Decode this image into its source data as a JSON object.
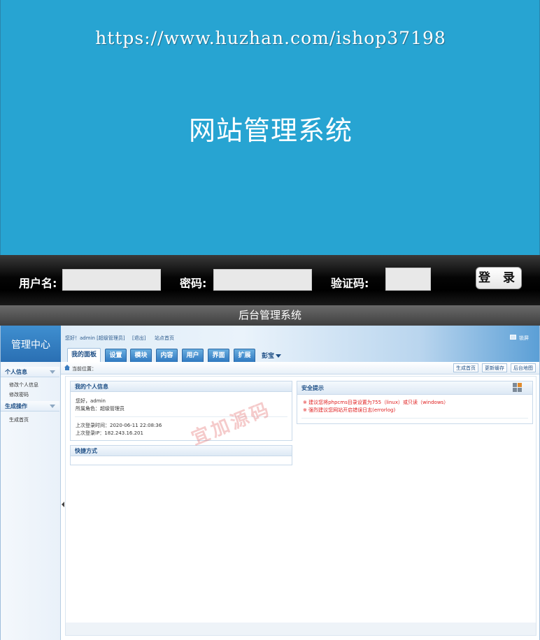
{
  "watermark_url": "https://www.huzhan.com/ishop37198",
  "login": {
    "title": "网站管理系统",
    "username_label": "用户名:",
    "password_label": "密码:",
    "captcha_label": "验证码:",
    "login_button": "登 录",
    "subtitle": "后台管理系统"
  },
  "admin": {
    "logo": "管理中心",
    "greeting": "您好！admin [超级管理员]",
    "logout": "[退出]",
    "site_home": "站点首页",
    "lock_screen": "锁屏",
    "tabs": [
      "我的面板",
      "设置",
      "模块",
      "内容",
      "用户",
      "界面",
      "扩展"
    ],
    "more_tab": "彭宝",
    "breadcrumb": "当前位置：",
    "quick_buttons": [
      "生成首页",
      "更新缓存",
      "后台地图"
    ],
    "sidebar": {
      "sections": [
        {
          "title": "个人信息",
          "items": [
            "修改个人信息",
            "修改密码"
          ]
        },
        {
          "title": "生成操作",
          "items": [
            "生成首页"
          ]
        }
      ]
    },
    "panels": {
      "my_info": {
        "title": "我的个人信息",
        "hello": "您好，admin",
        "role": "所属角色：超级管理员",
        "last_login_time": "上次登录时间：2020-06-11 22:08:36",
        "last_login_ip": "上次登录IP：182.243.16.201"
      },
      "shortcuts": {
        "title": "快捷方式"
      },
      "security": {
        "title": "安全提示",
        "tips": [
          "※ 建议您将phpcms目录设置为755（linux）或只读（windows）",
          "※ 强烈建议您网站开启错误日志(errorlog)"
        ]
      }
    },
    "stamp": "宜加源码"
  },
  "colors": {
    "hero_bg": "#27a4d2",
    "admin_blue": "#2f79c0",
    "warning": "#e02020"
  }
}
